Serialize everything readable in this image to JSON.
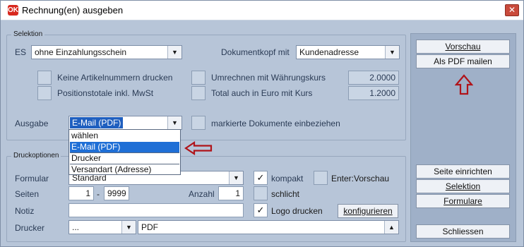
{
  "window": {
    "title": "Rechnung(en) ausgeben",
    "close_glyph": "✕",
    "app_icon": "ok-logo-icon"
  },
  "selektion": {
    "legend": "Selektion",
    "es_label": "ES",
    "es_value": "ohne Einzahlungsschein",
    "dokumentkopf_label": "Dokumentkopf mit",
    "dokumentkopf_value": "Kundenadresse",
    "keine_artikelnummern": "Keine Artikelnummern drucken",
    "positionstotale": "Positionstotale inkl. MwSt",
    "umrechnen": "Umrechnen mit Währungskurs",
    "umrechnen_value": "2.0000",
    "total_euro": "Total auch in Euro mit Kurs",
    "total_euro_value": "1.2000",
    "ausgabe_label": "Ausgabe",
    "ausgabe_value": "E-Mail (PDF)",
    "markierte": "markierte Dokumente einbeziehen"
  },
  "dropdown": {
    "options": [
      "wählen",
      "E-Mail (PDF)",
      "Drucker",
      "Versandart (Adresse)"
    ],
    "selected_index": 1
  },
  "druckoptionen": {
    "legend": "Druckoptionen",
    "formular_label": "Formular",
    "formular_value": "Standard",
    "kompakt": "kompakt",
    "kompakt_checked": "✓",
    "enter_vorschau": "Enter:Vorschau",
    "seiten_label": "Seiten",
    "seiten_from": "1",
    "seiten_sep": "-",
    "seiten_to": "9999",
    "anzahl_label": "Anzahl",
    "anzahl_value": "1",
    "schlicht": "schlicht",
    "notiz_label": "Notiz",
    "notiz_value": "",
    "logo_drucken": "Logo drucken",
    "logo_checked": "✓",
    "konfigurieren_label": "konfigurieren",
    "drucker_label": "Drucker",
    "drucker_combo_value": "...",
    "drucker_value": "PDF"
  },
  "right_panel": {
    "vorschau": "Vorschau",
    "als_pdf_mailen": "Als PDF mailen",
    "seite_einrichten": "Seite einrichten",
    "selektion": "Selektion",
    "formulare": "Formulare",
    "schliessen": "Schliessen"
  },
  "colors": {
    "annotation_arrow": "#b0141a",
    "selection_blue": "#1f6fd6",
    "dialog_bg": "#b7c5d8"
  }
}
